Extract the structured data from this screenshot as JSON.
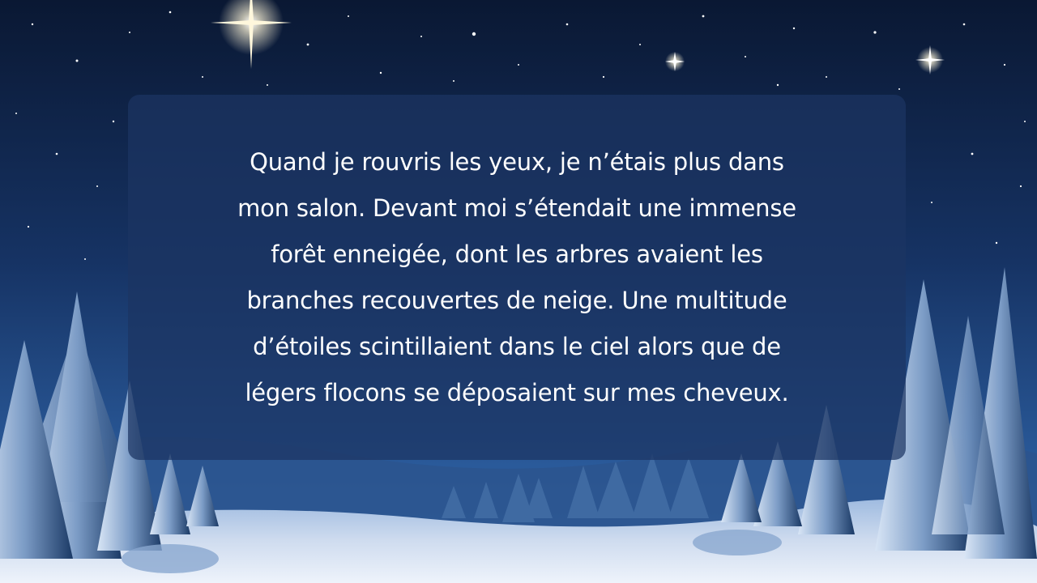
{
  "slide": {
    "lines": [
      "Quand je rouvris les yeux, je n’étais plus dans",
      "mon salon. Devant moi s’étendait une immense",
      "forêt enneigée, dont les arbres avaient les",
      "branches recouvertes de neige. Une multitude",
      "d’étoiles scintillaient dans le ciel alors que de",
      "légers flocons se déposaient sur mes cheveux."
    ]
  },
  "colors": {
    "sky_top": "#0a1a3a",
    "sky_mid": "#1d3f78",
    "panel": "#1c3462",
    "snow": "#dfe9f7",
    "text": "#ffffff"
  }
}
